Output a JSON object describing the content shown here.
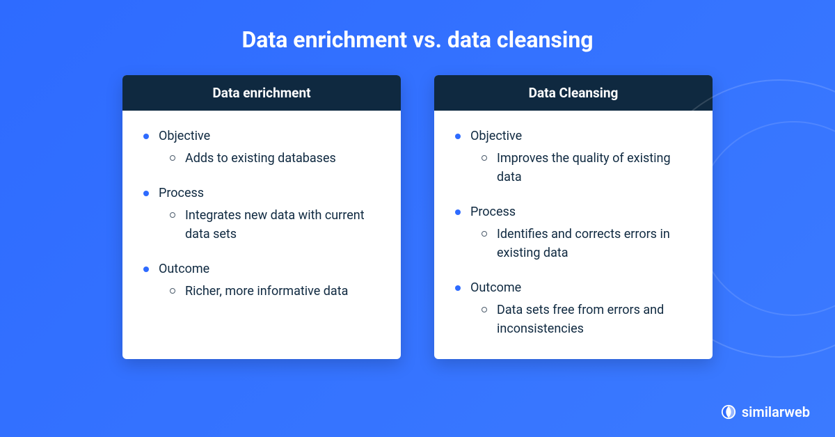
{
  "title": "Data enrichment vs. data cleansing",
  "cards": [
    {
      "header": "Data enrichment",
      "sections": [
        {
          "label": "Objective",
          "detail": "Adds to existing databases"
        },
        {
          "label": "Process",
          "detail": "Integrates new data with current data sets"
        },
        {
          "label": "Outcome",
          "detail": "Richer, more informative data"
        }
      ]
    },
    {
      "header": "Data Cleansing",
      "sections": [
        {
          "label": "Objective",
          "detail": "Improves the quality of existing data"
        },
        {
          "label": "Process",
          "detail": "Identifies and corrects errors in existing data"
        },
        {
          "label": "Outcome",
          "detail": "Data sets free from errors and inconsistencies"
        }
      ]
    }
  ],
  "brand": "similarweb"
}
